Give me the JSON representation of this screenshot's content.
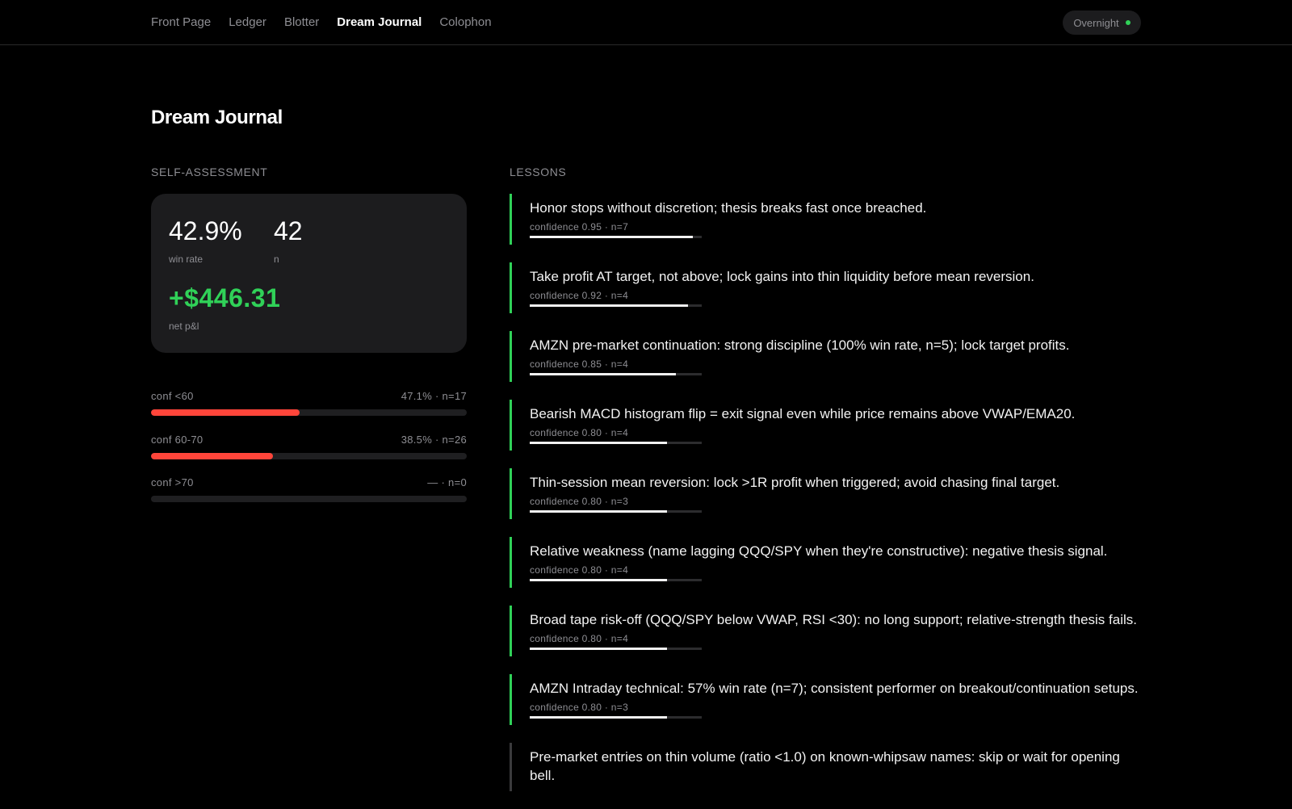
{
  "nav": {
    "items": [
      {
        "label": "Front Page",
        "active": false
      },
      {
        "label": "Ledger",
        "active": false
      },
      {
        "label": "Blotter",
        "active": false
      },
      {
        "label": "Dream Journal",
        "active": true
      },
      {
        "label": "Colophon",
        "active": false
      }
    ],
    "mode": "Overnight",
    "mode_status_color": "#30d158"
  },
  "page": {
    "title": "Dream Journal"
  },
  "self_assessment": {
    "label": "SELF-ASSESSMENT",
    "win_rate": "42.9%",
    "win_rate_caption": "win rate",
    "n": "42",
    "n_caption": "n",
    "net_pnl": "+$446.31",
    "net_pnl_caption": "net p&l",
    "buckets": [
      {
        "label": "conf <60",
        "stats": "47.1% · n=17",
        "win_rate": 0.471
      },
      {
        "label": "conf 60-70",
        "stats": "38.5% · n=26",
        "win_rate": 0.385
      },
      {
        "label": "conf >70",
        "stats": "— · n=0",
        "win_rate": 0
      }
    ]
  },
  "lessons": {
    "label": "LESSONS",
    "items": [
      {
        "text": "Honor stops without discretion; thesis breaks fast once breached.",
        "meta": "confidence 0.95 · n=7",
        "confidence": 0.95
      },
      {
        "text": "Take profit AT target, not above; lock gains into thin liquidity before mean reversion.",
        "meta": "confidence 0.92 · n=4",
        "confidence": 0.92
      },
      {
        "text": "AMZN pre-market continuation: strong discipline (100% win rate, n=5); lock target profits.",
        "meta": "confidence 0.85 · n=4",
        "confidence": 0.85
      },
      {
        "text": "Bearish MACD histogram flip = exit signal even while price remains above VWAP/EMA20.",
        "meta": "confidence 0.80 · n=4",
        "confidence": 0.8
      },
      {
        "text": "Thin-session mean reversion: lock >1R profit when triggered; avoid chasing final target.",
        "meta": "confidence 0.80 · n=3",
        "confidence": 0.8
      },
      {
        "text": "Relative weakness (name lagging QQQ/SPY when they're constructive): negative thesis signal.",
        "meta": "confidence 0.80 · n=4",
        "confidence": 0.8
      },
      {
        "text": "Broad tape risk-off (QQQ/SPY below VWAP, RSI <30): no long support; relative-strength thesis fails.",
        "meta": "confidence 0.80 · n=4",
        "confidence": 0.8
      },
      {
        "text": "AMZN Intraday technical: 57% win rate (n=7); consistent performer on breakout/continuation setups.",
        "meta": "confidence 0.80 · n=3",
        "confidence": 0.8
      },
      {
        "text": "Pre-market entries on thin volume (ratio <1.0) on known-whipsaw names: skip or wait for opening bell.",
        "meta": "",
        "confidence": 0,
        "muted": true
      }
    ]
  }
}
